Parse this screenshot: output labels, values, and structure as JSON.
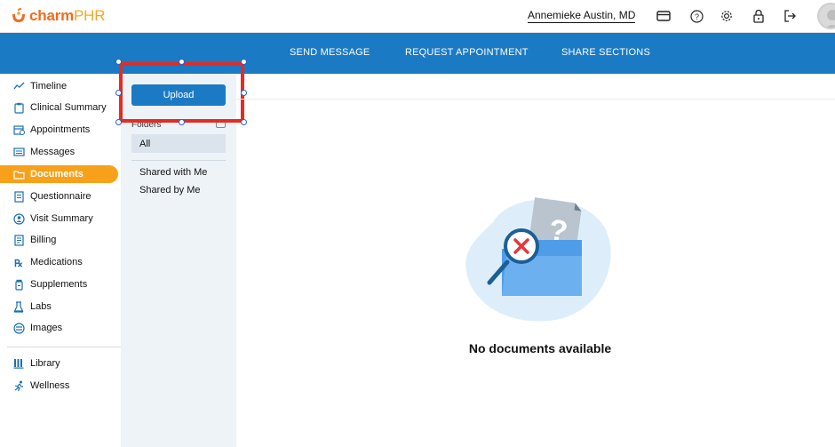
{
  "brand": {
    "name_part1": "charm",
    "name_part2": "PHR",
    "accent": "#f26a21",
    "accent2": "#f5a623"
  },
  "header": {
    "user_name": "Annemieke Austin, MD",
    "icons": [
      "card-icon",
      "help-icon",
      "gear-icon",
      "lock-icon",
      "logout-icon",
      "avatar"
    ]
  },
  "nav": {
    "send_message": "SEND MESSAGE",
    "request_appointment": "REQUEST APPOINTMENT",
    "share_sections": "SHARE SECTIONS",
    "color": "#1b7ac4"
  },
  "sidebar": {
    "items": [
      {
        "label": "Timeline",
        "icon": "timeline-icon"
      },
      {
        "label": "Clinical Summary",
        "icon": "clipboard-icon"
      },
      {
        "label": "Appointments",
        "icon": "calendar-icon"
      },
      {
        "label": "Messages",
        "icon": "message-icon"
      },
      {
        "label": "Documents",
        "icon": "folder-icon",
        "active": true
      },
      {
        "label": "Questionnaire",
        "icon": "questionnaire-icon"
      },
      {
        "label": "Visit Summary",
        "icon": "visit-icon"
      },
      {
        "label": "Billing",
        "icon": "billing-icon"
      },
      {
        "label": "Medications",
        "icon": "rx-icon"
      },
      {
        "label": "Supplements",
        "icon": "supplement-icon"
      },
      {
        "label": "Labs",
        "icon": "flask-icon"
      },
      {
        "label": "Images",
        "icon": "image-icon"
      },
      {
        "label": "Library",
        "icon": "library-icon"
      },
      {
        "label": "Wellness",
        "icon": "running-icon"
      }
    ],
    "active_color": "#f7a11a"
  },
  "documents_panel": {
    "upload_label": "Upload",
    "folders_header": "Folders",
    "folders": [
      "All",
      "Shared with Me",
      "Shared by Me"
    ],
    "selected_folder": "All"
  },
  "main": {
    "empty_message": "No documents available"
  },
  "annotation": {
    "color": "#e52b24"
  }
}
